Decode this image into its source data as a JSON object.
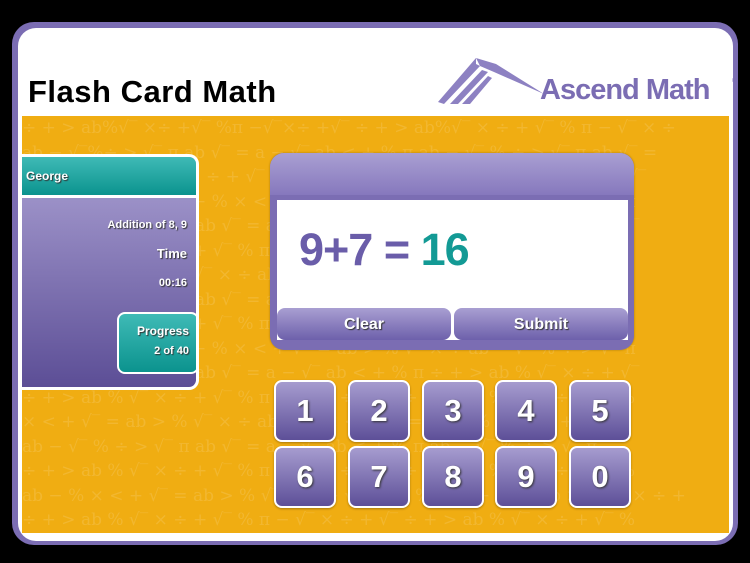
{
  "app": {
    "title": "Flash Card Math",
    "logo_text": "Ascend Math",
    "logo_mark": "®"
  },
  "student": {
    "name": "George",
    "skill": "Addition of 8, 9",
    "time_label": "Time",
    "time_value": "00:16",
    "progress_label": "Progress",
    "progress_value": "2 of 40",
    "progress_current": 2,
    "progress_total": 40
  },
  "question": {
    "expression": "9+7 = ",
    "answer": "16",
    "clear_label": "Clear",
    "submit_label": "Submit"
  },
  "keypad": {
    "keys": [
      "1",
      "2",
      "3",
      "4",
      "5",
      "6",
      "7",
      "8",
      "9",
      "0"
    ]
  },
  "background_pattern": [
    "÷ + > ab%√‾ ×÷ +√‾ %π −√‾×÷ +√‾ ÷ + > ab%√‾ × ÷ + √‾ % π − √‾ × ÷",
    "ab − √‾%÷ > √‾ π ab √‾ = a − √‾ ab < + % π ab − √‾ % ÷ > √‾ π ab √‾ =",
    "% π ÷ + > ab %√‾ × ÷ + √‾ % π − √‾ × ÷ + √‾ ÷ + > ab % √‾ × ÷ + √‾",
    "> √‾ = a ÷ √‾ < ab − % × < + √‾ = ab > % √‾ × ÷ ab − √‾ % ÷ > √‾ π",
    "ab − √‾ % ÷ > √‾ π ab √‾ = a − √‾ ab < + % π ÷ + > ab % √‾ × ÷ + √‾",
    "÷ + > ab % √‾ × ÷ + √‾ % π − √‾ × ÷ + √‾ ÷ + > ab % √‾ × ÷ + √‾ %",
    "× < + √‾ = ab > % √‾ × ÷ ab − % × < + √‾ = ab > % √‾ × ÷ + π ab",
    "ab − √‾ % ÷ > √‾ π ab √‾ = a − √‾ ab < + % π ab − √‾ % ÷ > √‾ π",
    "÷ + > ab % √‾ × ÷ + √‾ % π − √‾ × ÷ + √‾ ÷ + > ab % √‾ × ÷ + √‾ %",
    "> √‾ = a ÷ √‾ < ab − % × < + √‾ = ab > % √‾ × ÷ ab − √‾ % ÷ > √‾ π",
    "ab − √‾ % ÷ > √‾ π ab √‾ = a − √‾ ab < + % π ÷ + > ab % √‾ × ÷ + √‾",
    "÷ + > ab % √‾ × ÷ + √‾ % π − √‾ × ÷ + √‾ ÷ + > ab % √‾ × ÷ + √‾ %",
    "× < + √‾ = ab > % √‾ × ÷ ab − % × < + √‾ = ab > % √‾ × ÷ + π ab",
    "ab − √‾ % ÷ > √‾ π ab √‾ = a − √‾ ab < + % π ab − √‾ % ÷ > √‾ π",
    "÷ + > ab % √‾ × ÷ + √‾ % π − √‾ × ÷ + √‾ ÷ + > ab % √‾ × ÷ + √‾ %",
    "ab − % × < + √‾ = ab > % √‾ × ÷ + √‾ ab − % × < + √‾ = ab > % √‾ × ÷ +",
    "÷ + > ab % √‾ × ÷ + √‾ % π − √‾ × ÷ + √‾ ÷ + > ab % √‾ × ÷ + √‾ %"
  ],
  "colors": {
    "frame_purple": "#7b6db3",
    "stage_orange": "#f0ad12",
    "teal": "#139a95",
    "text_purple": "#6a5da9"
  }
}
